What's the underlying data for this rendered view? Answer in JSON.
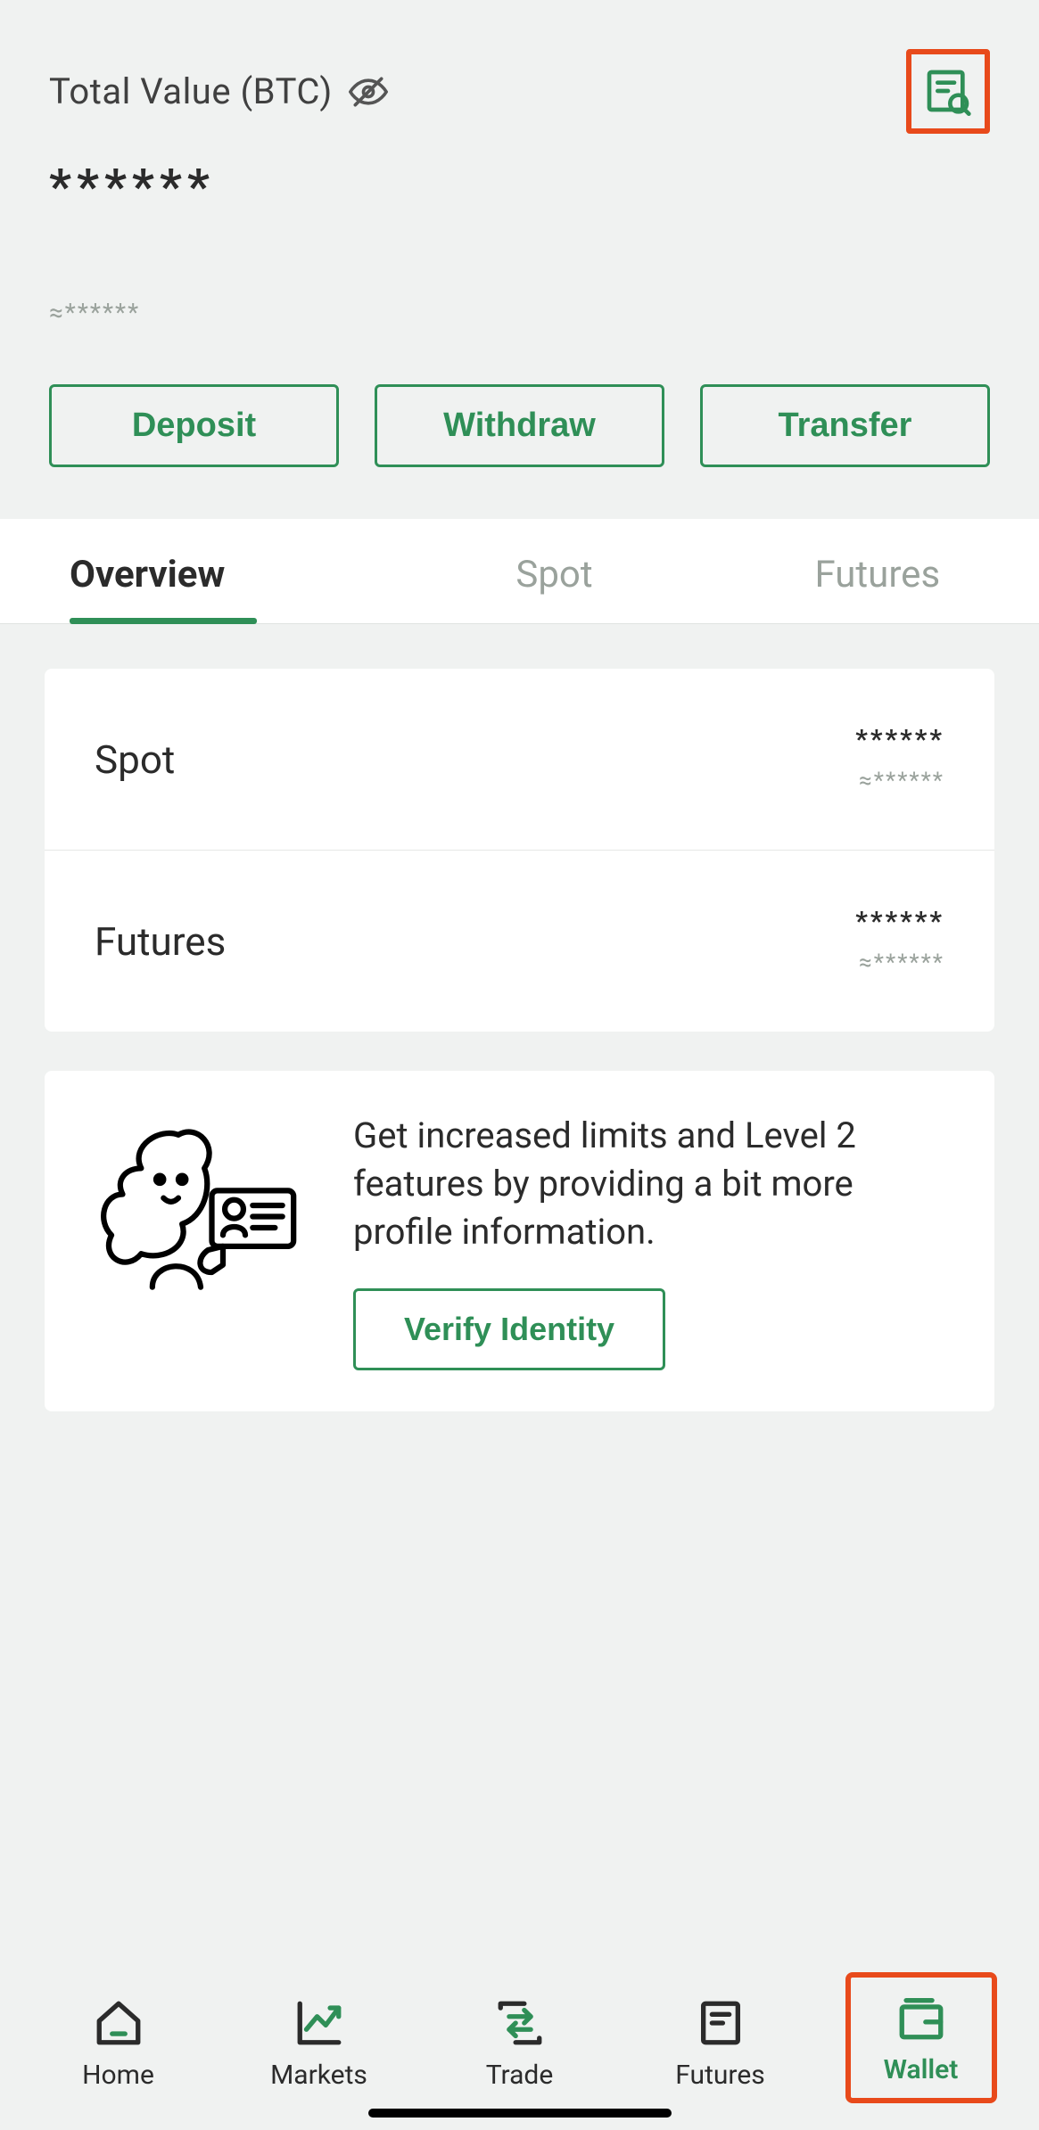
{
  "header": {
    "total_label": "Total Value (BTC)",
    "total_value": "******",
    "total_approx": "≈******"
  },
  "actions": {
    "deposit": "Deposit",
    "withdraw": "Withdraw",
    "transfer": "Transfer"
  },
  "tabs": {
    "overview": "Overview",
    "spot": "Spot",
    "futures": "Futures"
  },
  "balances": {
    "spot": {
      "label": "Spot",
      "value": "******",
      "approx": "≈******"
    },
    "futures": {
      "label": "Futures",
      "value": "******",
      "approx": "≈******"
    }
  },
  "verify": {
    "text": "Get increased limits and Level 2 features by providing a bit more profile information.",
    "button": "Verify Identity"
  },
  "nav": {
    "home": "Home",
    "markets": "Markets",
    "trade": "Trade",
    "futures": "Futures",
    "wallet": "Wallet"
  },
  "colors": {
    "accent": "#2f8f57",
    "highlight": "#e84a1b",
    "muted": "#9aa29c"
  }
}
